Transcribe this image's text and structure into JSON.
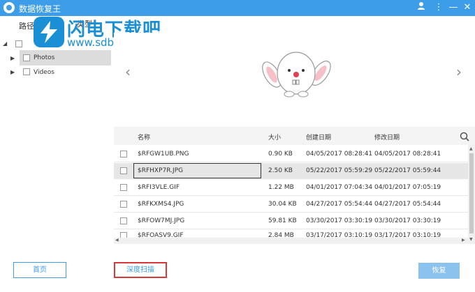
{
  "app": {
    "title": "数据恢复王"
  },
  "tabs": {
    "path": "路径",
    "type": "类型"
  },
  "watermark": {
    "title": "闪电下载吧",
    "url": "www.sdbeta.com"
  },
  "tree": {
    "items": [
      {
        "label": "Photos",
        "selected": true
      },
      {
        "label": "Videos",
        "selected": false
      }
    ]
  },
  "table": {
    "columns": {
      "name": "名称",
      "size": "大小",
      "created": "创建日期",
      "modified": "修改日期"
    },
    "rows": [
      {
        "name": "$RFGW1UB.PNG",
        "size": "0.90 KB",
        "created": "04/05/2017 08:28:41",
        "modified": "04/05/2017 08:28:41"
      },
      {
        "name": "$RFHXP7R.JPG",
        "size": "2.50 KB",
        "created": "05/22/2017 05:59:29",
        "modified": "05/22/2017 05:59:44"
      },
      {
        "name": "$RFI3VLE.GIF",
        "size": "1.22 MB",
        "created": "04/01/2017 07:04:34",
        "modified": "04/01/2017 07:05:19"
      },
      {
        "name": "$RFKXMS4.JPG",
        "size": "30.04 KB",
        "created": "04/27/2017 05:54:44",
        "modified": "04/27/2017 05:54:44"
      },
      {
        "name": "$RFOW7MJ.JPG",
        "size": "59.81 KB",
        "created": "03/30/2017 03:30:19",
        "modified": "03/30/2017 03:30:19"
      },
      {
        "name": "$RFOASV9.GIF",
        "size": "2.84 MB",
        "created": "03/17/2017 03:10:19",
        "modified": "03/17/2017 03:10:19"
      }
    ]
  },
  "footer": {
    "home": "首页",
    "deep_scan": "深度扫描",
    "recover": "恢复"
  },
  "colors": {
    "accent": "#3d9de8",
    "highlight": "#d9373a"
  }
}
